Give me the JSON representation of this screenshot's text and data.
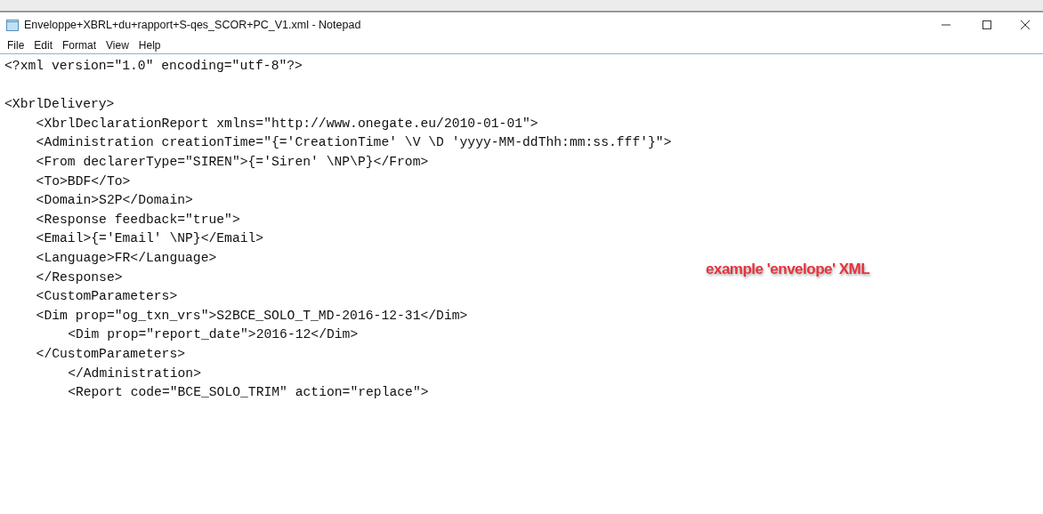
{
  "window": {
    "title": "Enveloppe+XBRL+du+rapport+S-qes_SCOR+PC_V1.xml - Notepad"
  },
  "menu": [
    "File",
    "Edit",
    "Format",
    "View",
    "Help"
  ],
  "editor": {
    "lines": [
      "<?xml version=\"1.0\" encoding=\"utf-8\"?>",
      "\n<XbrlDelivery>",
      "\t<XbrlDeclarationReport xmlns=\"http://www.onegate.eu/2010-01-01\">",
      "\t<Administration creationTime=\"{='CreationTime' \\V \\D 'yyyy-MM-ddThh:mm:ss.fff'}\">",
      "\t<From declarerType=\"SIREN\">{='Siren' \\NP\\P}</From>",
      "\t<To>BDF</To>",
      "\t<Domain>S2P</Domain>",
      "\t<Response feedback=\"true\">",
      "\t<Email>{='Email' \\NP}</Email>",
      "\t<Language>FR</Language>",
      "\t</Response>",
      "\t<CustomParameters>",
      "\t<Dim prop=\"og_txn_vrs\">S2BCE_SOLO_T_MD-2016-12-31</Dim>",
      "\t\t<Dim prop=\"report_date\">2016-12</Dim>",
      "\t</CustomParameters>",
      "\t\t</Administration>",
      "\t\t<Report code=\"BCE_SOLO_TRIM\" action=\"replace\">"
    ]
  },
  "annotation": {
    "text": "example 'envelope' XML"
  }
}
